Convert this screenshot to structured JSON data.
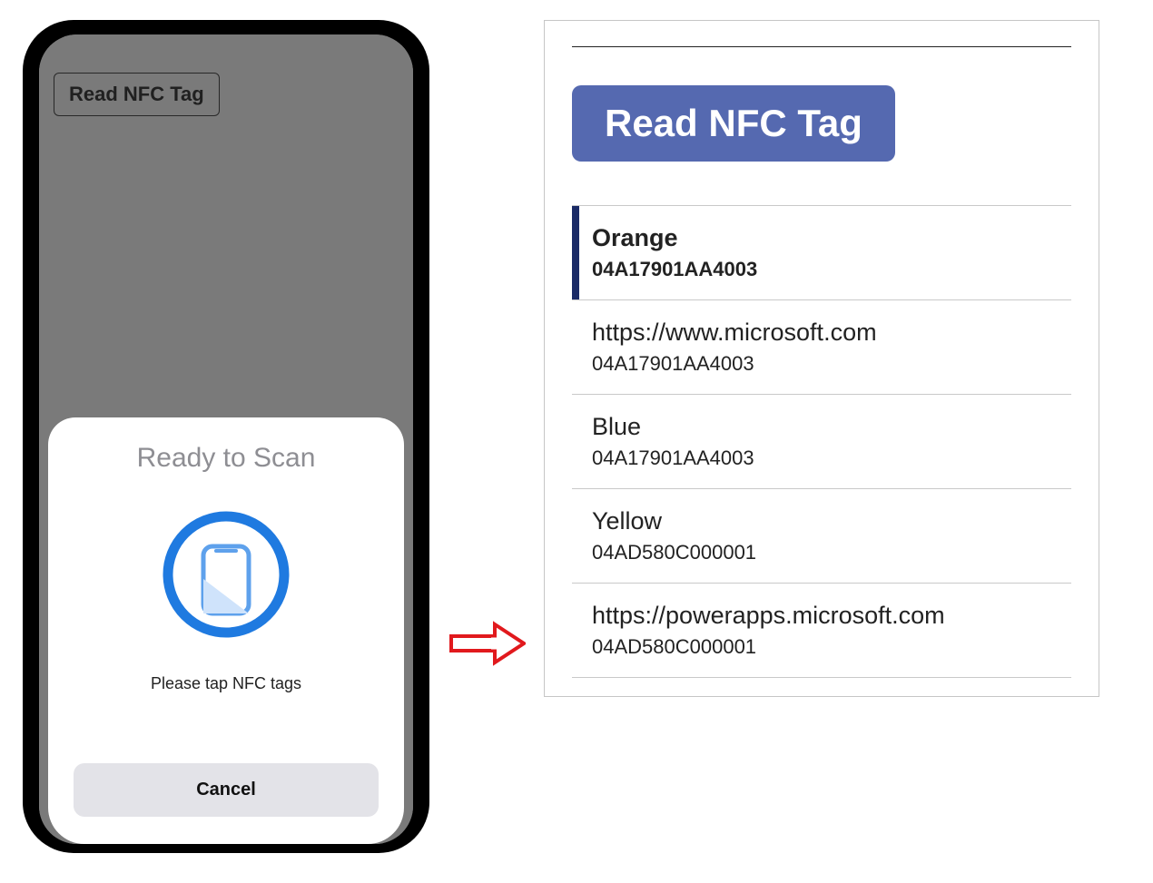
{
  "phone": {
    "behind_button_label": "Read NFC Tag",
    "sheet": {
      "title": "Ready to Scan",
      "subtitle": "Please tap NFC tags",
      "cancel_label": "Cancel"
    }
  },
  "panel": {
    "read_button_label": "Read NFC Tag",
    "items": [
      {
        "title": "Orange",
        "code": "04A17901AA4003",
        "selected": true
      },
      {
        "title": "https://www.microsoft.com",
        "code": "04A17901AA4003",
        "selected": false
      },
      {
        "title": "Blue",
        "code": "04A17901AA4003",
        "selected": false
      },
      {
        "title": "Yellow",
        "code": "04AD580C000001",
        "selected": false
      },
      {
        "title": "https://powerapps.microsoft.com",
        "code": "04AD580C000001",
        "selected": false
      }
    ]
  }
}
